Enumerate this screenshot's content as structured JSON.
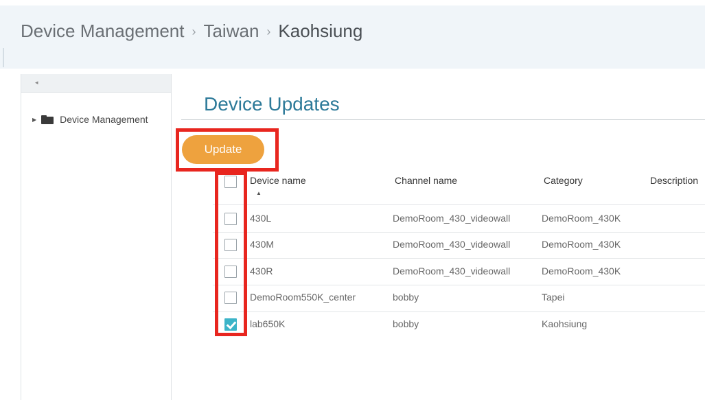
{
  "breadcrumb": [
    "Device Management",
    "Taiwan",
    "Kaohsiung"
  ],
  "sidebar": {
    "tree": [
      {
        "label": "Device Management"
      }
    ]
  },
  "panel": {
    "title": "Device Updates",
    "update_label": "Update"
  },
  "table": {
    "columns": [
      "Device name",
      "Channel name",
      "Category",
      "Description"
    ],
    "rows": [
      {
        "device": "430L",
        "channel": "DemoRoom_430_videowall",
        "category": "DemoRoom_430K",
        "description": "",
        "checked": false
      },
      {
        "device": "430M",
        "channel": "DemoRoom_430_videowall",
        "category": "DemoRoom_430K",
        "description": "",
        "checked": false
      },
      {
        "device": "430R",
        "channel": "DemoRoom_430_videowall",
        "category": "DemoRoom_430K",
        "description": "",
        "checked": false
      },
      {
        "device": "DemoRoom550K_center",
        "channel": "bobby",
        "category": "Tapei",
        "description": "",
        "checked": false
      },
      {
        "device": "lab650K",
        "channel": "bobby",
        "category": "Kaohsiung",
        "description": "",
        "checked": true
      }
    ]
  },
  "colors": {
    "accent": "#2d7a99",
    "button": "#eea23e",
    "checkbox_checked": "#3cb4c8",
    "highlight": "#e8261f"
  },
  "icons": {
    "tree_toggle": "caret-right-icon",
    "folder": "folder-icon",
    "sort": "sort-ascending-icon"
  }
}
